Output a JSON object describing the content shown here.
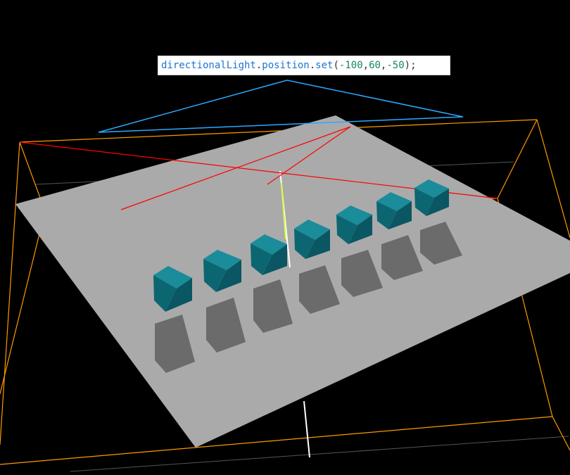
{
  "viewport": {
    "background": "#000000",
    "plane_color": "#aaaaaa",
    "cube_color": "#0f6b78",
    "shadow_color": "#6b6b6b",
    "camera_helper_color": "#ff9900",
    "light_helper_color": "#2aa8ff",
    "axis_red": "#ff0000"
  },
  "code_snippet": {
    "object": "directionalLight",
    "dot1": ".",
    "property": "position",
    "dot2": ".",
    "method": "set",
    "open_paren": "(",
    "arg_x": "-100",
    "comma1": ", ",
    "arg_y": "60",
    "comma2": ", ",
    "arg_z": "-50",
    "close": ");"
  }
}
